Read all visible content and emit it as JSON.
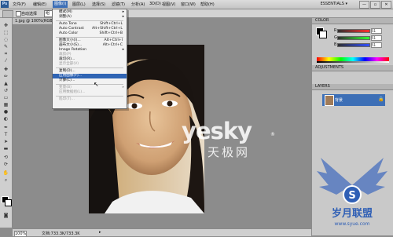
{
  "app": {
    "logo": "Ps",
    "workspace": "ESSENTIALS ▾"
  },
  "menubar": [
    "文件(F)",
    "编辑(E)",
    "图像(I)",
    "图层(L)",
    "选择(S)",
    "滤镜(T)",
    "分析(A)",
    "3D(D)",
    "视图(V)",
    "窗口(W)",
    "帮助(H)"
  ],
  "window_buttons": [
    "—",
    "▫",
    "✕"
  ],
  "options": {
    "auto_select_label": "自动选择",
    "auto_select_value": "组"
  },
  "document": {
    "tab": "1.jpg @ 100%(RGB/8)"
  },
  "status": {
    "zoom": "100%",
    "doc_info": "文档:733.3K/733.3K",
    "arrow": "▸"
  },
  "panels": {
    "color_header": "COLOR",
    "sliders": [
      {
        "label": "R",
        "value": "51",
        "color": "#e02020"
      },
      {
        "label": "G",
        "value": "51",
        "color": "#20a020"
      },
      {
        "label": "B",
        "value": "51",
        "color": "#2040e0"
      }
    ],
    "adjust_header": "ADJUSTMENTS",
    "layers_header": "LAYERS",
    "layer_name": "背景",
    "layer_lock": "🔒"
  },
  "image_menu": {
    "items": [
      {
        "label": "模式(M)",
        "shortcut": "",
        "submenu": true,
        "disabled": false
      },
      {
        "label": "调整(A)",
        "shortcut": "",
        "submenu": true,
        "disabled": false
      },
      {
        "sep": true
      },
      {
        "label": "Auto Tone",
        "shortcut": "Shift+Ctrl+L",
        "disabled": false
      },
      {
        "label": "Auto Contrast",
        "shortcut": "Alt+Shift+Ctrl+L",
        "disabled": false
      },
      {
        "label": "Auto Color",
        "shortcut": "Shift+Ctrl+B",
        "disabled": false
      },
      {
        "sep": true
      },
      {
        "label": "图像大小(I)...",
        "shortcut": "Alt+Ctrl+I",
        "disabled": false
      },
      {
        "label": "画布大小(S)...",
        "shortcut": "Alt+Ctrl+C",
        "disabled": false
      },
      {
        "label": "Image Rotation",
        "shortcut": "",
        "submenu": true,
        "disabled": false
      },
      {
        "label": "裁剪(P)",
        "shortcut": "",
        "disabled": true
      },
      {
        "label": "裁切(R)...",
        "shortcut": "",
        "disabled": false
      },
      {
        "label": "显示全部(V)",
        "shortcut": "",
        "disabled": true
      },
      {
        "sep": true
      },
      {
        "label": "复制(D)...",
        "shortcut": "",
        "disabled": false
      },
      {
        "label": "应用图像(Y)...",
        "shortcut": "",
        "disabled": false,
        "highlighted": true
      },
      {
        "label": "计算(C)...",
        "shortcut": "",
        "disabled": false
      },
      {
        "sep": true
      },
      {
        "label": "变量(B)",
        "shortcut": "",
        "submenu": true,
        "disabled": true
      },
      {
        "label": "应用数据组(L)...",
        "shortcut": "",
        "disabled": true
      },
      {
        "sep": true
      },
      {
        "label": "陷印(T)...",
        "shortcut": "",
        "disabled": true
      }
    ]
  },
  "watermark": {
    "brand": "yesky",
    "reg": "®",
    "cn": "天极网",
    "site_cn": "岁月联盟",
    "site_url": "www.syue.com",
    "badge": "S"
  }
}
